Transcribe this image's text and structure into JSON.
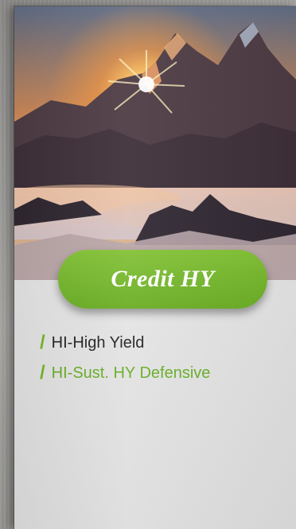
{
  "card": {
    "title": "Credit HY",
    "items": [
      {
        "label": "HI-High Yield"
      },
      {
        "label": "HI-Sust. HY Defensive"
      }
    ]
  },
  "colors": {
    "accent_green": "#69ad24",
    "text_dark": "#222222"
  },
  "icons": {
    "bullet": "slash-icon"
  }
}
